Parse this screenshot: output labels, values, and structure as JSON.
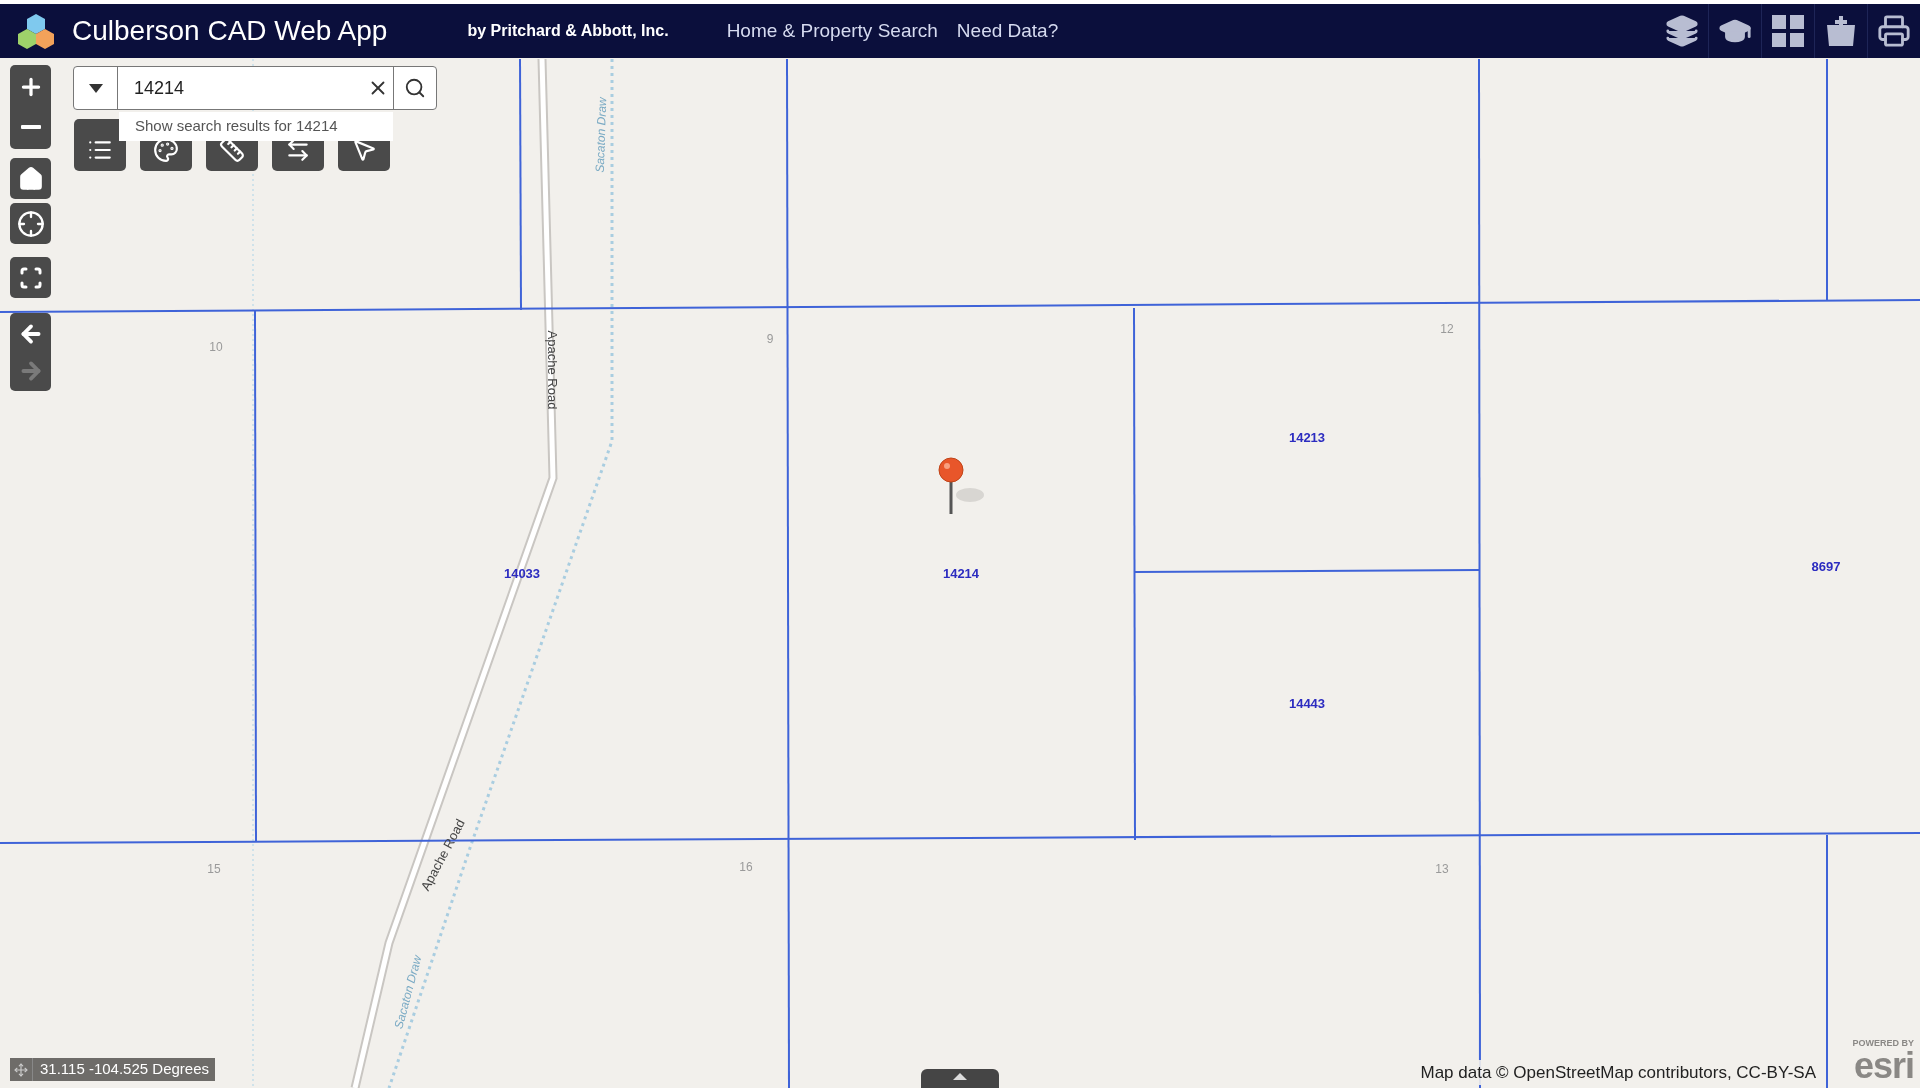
{
  "header": {
    "title": "Culberson CAD Web App",
    "subtitle": "by Pritchard & Abbott, Inc.",
    "nav": [
      "Home & Property Search",
      "Need Data?"
    ]
  },
  "search": {
    "value": "14214",
    "suggestion": "Show search results for 14214"
  },
  "history": [
    {
      "kind": "back",
      "disabled": false
    },
    {
      "kind": "forward",
      "disabled": true
    }
  ],
  "map": {
    "sections": [
      "10",
      "9",
      "12",
      "15",
      "16",
      "13"
    ],
    "parcels": [
      "14213",
      "14033",
      "14214",
      "8697",
      "14443"
    ],
    "roads": [
      "Apache Road",
      "Apache Road"
    ],
    "streams": [
      "Sacaton Draw",
      "Sacaton Draw"
    ]
  },
  "coordinates": "31.115 -104.525 Degrees",
  "attribution": "Map data © OpenStreetMap contributors, CC-BY-SA",
  "logo": {
    "caption": "POWERED BY",
    "name": "esri"
  }
}
